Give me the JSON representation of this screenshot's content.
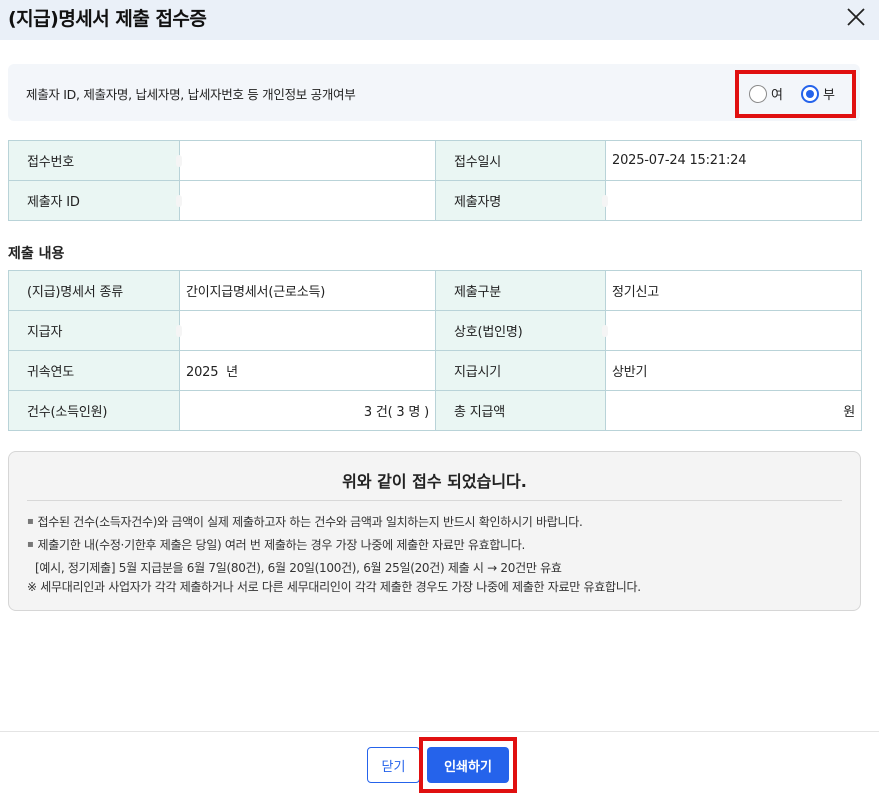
{
  "dialog": {
    "title": "(지급)명세서 제출 접수증",
    "close_icon": "close-icon"
  },
  "consent": {
    "label": "제출자 ID, 제출자명, 납세자명, 납세자번호 등 개인정보 공개여부",
    "options": [
      {
        "label": "여",
        "checked": false
      },
      {
        "label": "부",
        "checked": true
      }
    ]
  },
  "receipt": {
    "receipt_no_label": "접수번호",
    "receipt_no_value": "",
    "receipt_date_label": "접수일시",
    "receipt_date_value": "2025-07-24 15:21:24",
    "submitter_id_label": "제출자 ID",
    "submitter_id_value": "",
    "submitter_name_label": "제출자명",
    "submitter_name_value": ""
  },
  "content": {
    "section_title": "제출 내용",
    "statement_type_label": "(지급)명세서 종류",
    "statement_type_value": "간이지급명세서(근로소득)",
    "submit_type_label": "제출구분",
    "submit_type_value": "정기신고",
    "payer_label": "지급자",
    "payer_value": "",
    "company_label": "상호(법인명)",
    "company_value": "",
    "year_label": "귀속연도",
    "year_value": "2025  년",
    "period_label": "지급시기",
    "period_value": "상반기",
    "count_label": "건수(소득인원)",
    "count_value": "3 건( 3 명 )",
    "total_label": "총 지급액",
    "total_value": "원"
  },
  "notice": {
    "headline": "위와 같이 접수 되었습니다.",
    "lines": [
      "접수된 건수(소득자건수)와 금액이 실제 제출하고자 하는 건수와 금액과 일치하는지 반드시 확인하시기 바랍니다.",
      "제출기한 내(수정·기한후 제출은 당일) 여러 번 제출하는 경우 가장 나중에 제출한 자료만 유효합니다.",
      "[예시, 정기제출] 5월 지급분을 6월 7일(80건), 6월 20일(100건), 6월 25일(20건) 제출 시 → 20건만 유효",
      "※ 세무대리인과 사업자가 각각 제출하거나 서로 다른 세무대리인이 각각 제출한 경우도 가장 나중에 제출한 자료만 유효합니다."
    ]
  },
  "footer": {
    "close_label": "닫기",
    "print_label": "인쇄하기"
  },
  "colors": {
    "accent": "#2563eb",
    "highlight_box": "#e01010",
    "table_header_bg": "#eaf6f3",
    "table_border": "#b9d3d8"
  }
}
